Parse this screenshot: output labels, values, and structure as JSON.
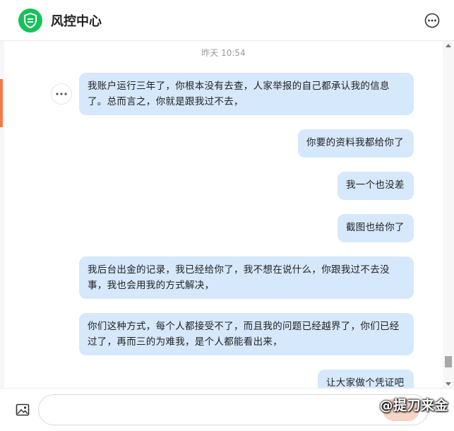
{
  "header": {
    "title": "风控中心"
  },
  "chat": {
    "timestamp": "昨天 10:54",
    "messages": [
      {
        "text": "我账户运行三年了，你根本没有去查，人家举报的自己都承认我的信息了。总而言之，你就是跟我过不去，"
      },
      {
        "text": "你要的资料我都给你了"
      },
      {
        "text": "我一个也没差"
      },
      {
        "text": "截图也给你了"
      },
      {
        "text": "我后台出金的记录，我已经给你了，我不想在说什么，你跟我过不去没事，我也会用我的方式解决，"
      },
      {
        "text": "你们这种方式，每个人都接受不了，而且我的问题已经越界了，你们已经过了，再而三的为难我，是个人都能看出来，"
      },
      {
        "text": "让大家做个凭证吧"
      }
    ]
  },
  "input": {
    "placeholder": ""
  },
  "watermark": {
    "text": "@提刀来金"
  },
  "colors": {
    "brand": "#17c25a",
    "bubble": "#d6e8fb",
    "accent": "#f07a4b"
  }
}
